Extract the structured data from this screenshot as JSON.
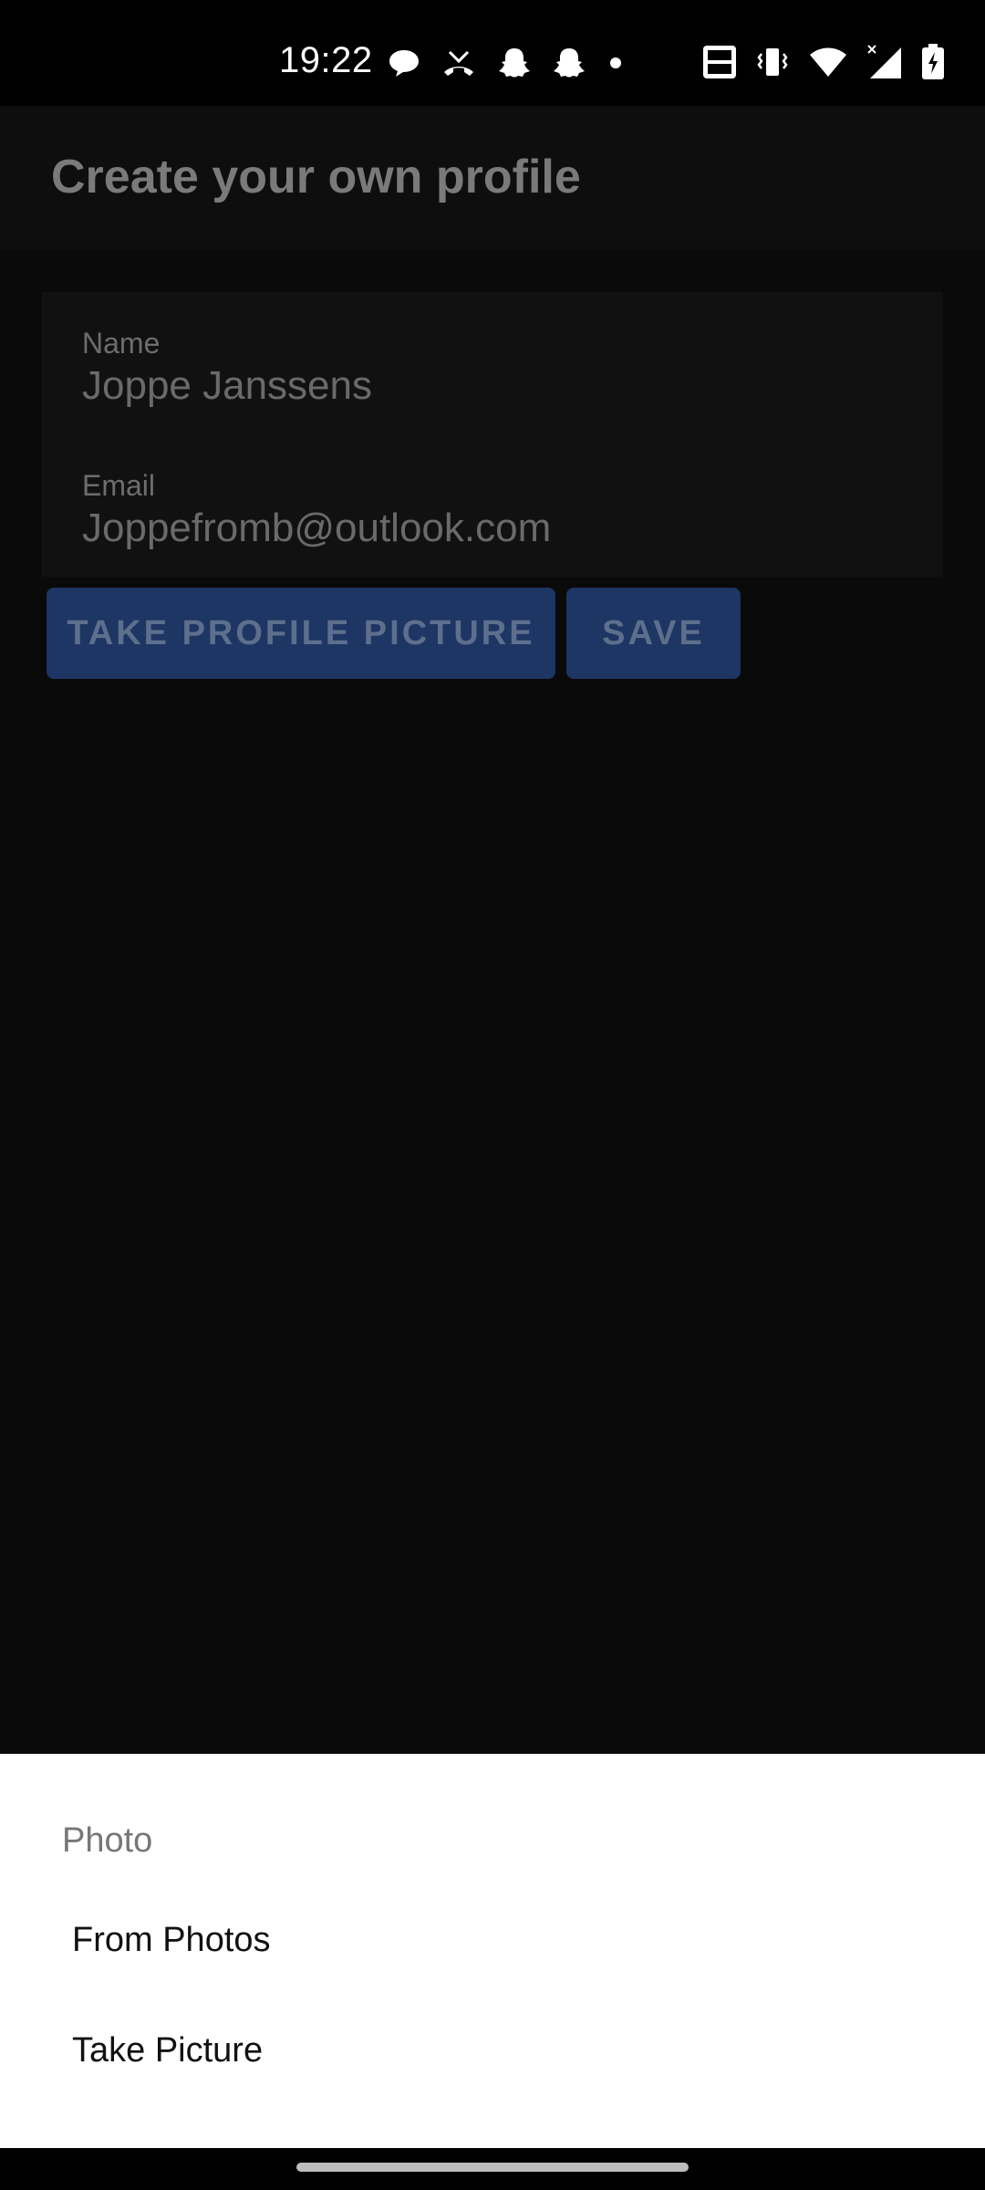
{
  "status_bar": {
    "time": "19:22",
    "icons_left": [
      "chat-bubble-icon",
      "missed-call-icon",
      "snapchat-ghost-icon",
      "snapchat-ghost-icon",
      "dot-icon"
    ],
    "icons_right": [
      "volte-icon",
      "vibrate-icon",
      "wifi-icon",
      "signal-icon",
      "battery-charging-icon"
    ]
  },
  "app_bar": {
    "title": "Create your own profile"
  },
  "form": {
    "name_label": "Name",
    "name_value": "Joppe Janssens",
    "email_label": "Email",
    "email_value": "Joppefromb@outlook.com"
  },
  "buttons": {
    "take_picture": "TAKE PROFILE PICTURE",
    "save": "SAVE"
  },
  "sheet": {
    "title": "Photo",
    "options": [
      "From Photos",
      "Take Picture"
    ]
  },
  "colors": {
    "button_bg": "#1d3663",
    "sheet_bg": "#ffffff",
    "overlay": "#0a0a0a"
  }
}
